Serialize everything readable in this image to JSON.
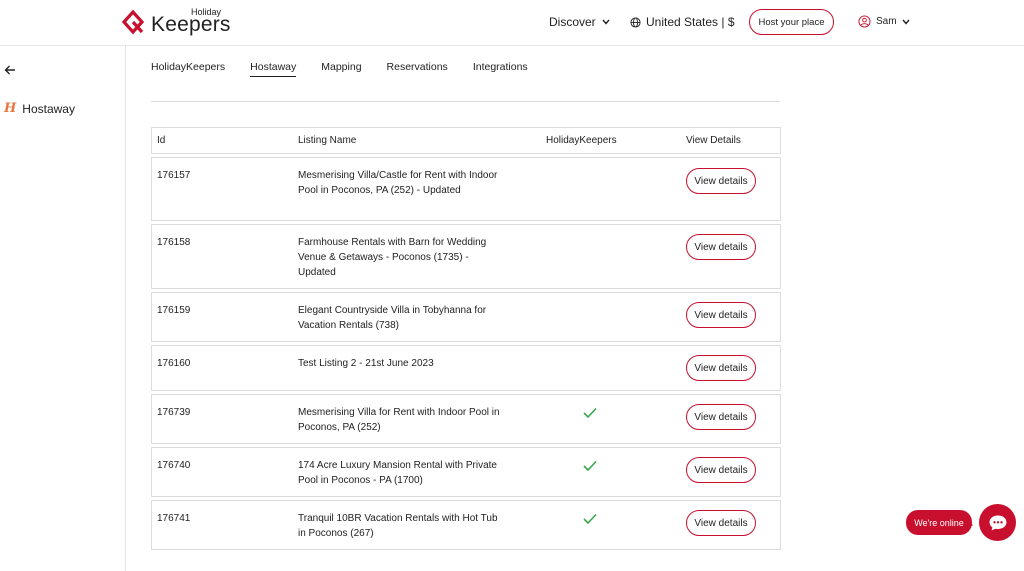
{
  "brand": {
    "logo_small": "Holiday",
    "logo_big": "Keepers",
    "accent_color": "#c8102e"
  },
  "header": {
    "discover_label": "Discover",
    "country_label": "United States | $",
    "host_button_label": "Host your place",
    "user_name": "Sam"
  },
  "sidebar": {
    "back_icon": "arrow-left-icon",
    "item_icon_glyph": "H",
    "item_label": "Hostaway"
  },
  "tabs": [
    {
      "label": "HolidayKeepers",
      "active": false
    },
    {
      "label": "Hostaway",
      "active": true
    },
    {
      "label": "Mapping",
      "active": false
    },
    {
      "label": "Reservations",
      "active": false
    },
    {
      "label": "Integrations",
      "active": false
    }
  ],
  "table": {
    "columns": [
      "Id",
      "Listing Name",
      "HolidayKeepers",
      "View Details"
    ],
    "rows": [
      {
        "id": "176157",
        "name": "Mesmerising Villa/Castle for Rent with Indoor Pool in Poconos, PA (252) - Updated",
        "holidaykeepers": false,
        "action": "View details"
      },
      {
        "id": "176158",
        "name": "Farmhouse Rentals with Barn for Wedding Venue & Getaways - Poconos (1735) - Updated",
        "holidaykeepers": false,
        "action": "View details"
      },
      {
        "id": "176159",
        "name": "Elegant Countryside Villa in Tobyhanna for Vacation Rentals (738)",
        "holidaykeepers": false,
        "action": "View details"
      },
      {
        "id": "176160",
        "name": "Test Listing 2 - 21st June 2023",
        "holidaykeepers": false,
        "action": "View details"
      },
      {
        "id": "176739",
        "name": "Mesmerising Villa for Rent with Indoor Pool in Poconos, PA (252)",
        "holidaykeepers": true,
        "action": "View details"
      },
      {
        "id": "176740",
        "name": "174 Acre Luxury Mansion Rental with Private Pool in Poconos - PA (1700)",
        "holidaykeepers": true,
        "action": "View details"
      },
      {
        "id": "176741",
        "name": "Tranquil 10BR Vacation Rentals with Hot Tub in Poconos (267)",
        "holidaykeepers": true,
        "action": "View details"
      }
    ]
  },
  "chat": {
    "label": "We're online",
    "icon": "chat-bubble-icon"
  }
}
